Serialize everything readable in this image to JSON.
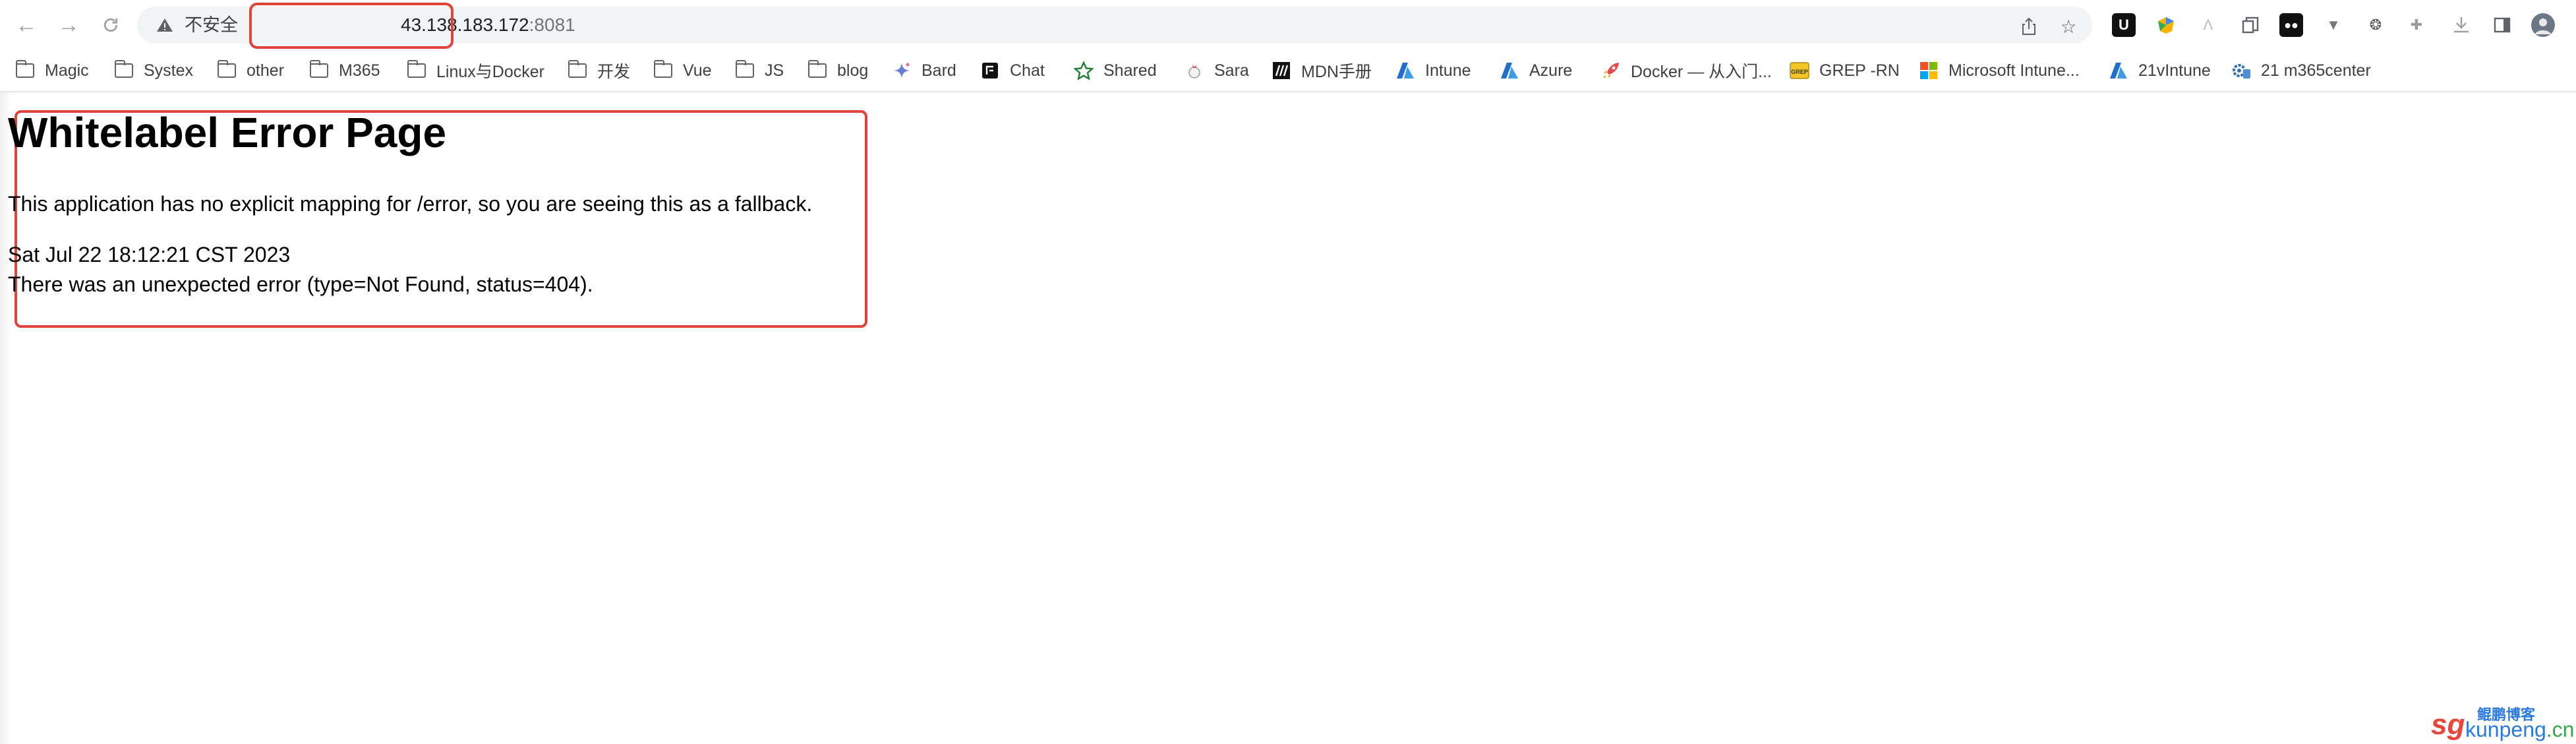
{
  "browser": {
    "address_bar": {
      "security_label": "不安全",
      "url_host": "43.138.183.172",
      "url_port": ":8081"
    }
  },
  "bookmarks": [
    {
      "label": "Magic",
      "icon": "folder-icon"
    },
    {
      "label": "Systex",
      "icon": "folder-icon"
    },
    {
      "label": "other",
      "icon": "folder-icon"
    },
    {
      "label": "M365",
      "icon": "folder-icon"
    },
    {
      "label": "Linux与Docker",
      "icon": "folder-icon"
    },
    {
      "label": "开发",
      "icon": "folder-icon"
    },
    {
      "label": "Vue",
      "icon": "folder-icon"
    },
    {
      "label": "JS",
      "icon": "folder-icon"
    },
    {
      "label": "blog",
      "icon": "folder-icon"
    },
    {
      "label": "Bard",
      "icon": "bard-sparkle-icon"
    },
    {
      "label": "Chat",
      "icon": "chat-icon"
    },
    {
      "label": "Shared",
      "icon": "star-icon"
    },
    {
      "label": "Sara",
      "icon": "rooster-icon"
    },
    {
      "label": "MDN手册",
      "icon": "mdn-icon"
    },
    {
      "label": "Intune",
      "icon": "azure-icon"
    },
    {
      "label": "Azure",
      "icon": "azure-icon"
    },
    {
      "label": "Docker — 从入门...",
      "icon": "rocket-icon"
    },
    {
      "label": "GREP -RN",
      "icon": "grep-icon"
    },
    {
      "label": "Microsoft Intune...",
      "icon": "microsoft-icon"
    },
    {
      "label": "21vIntune",
      "icon": "azure-icon"
    },
    {
      "label": "21 m365center",
      "icon": "gear-icon"
    }
  ],
  "page": {
    "title": "Whitelabel Error Page",
    "message": "This application has no explicit mapping for /error, so you are seeing this as a fallback.",
    "timestamp": "Sat Jul 22 18:12:21 CST 2023",
    "detail": "There was an unexpected error (type=Not Found, status=404)."
  },
  "watermark": {
    "site_name": "鲲鹏博客",
    "prefix": "sg",
    "domain": "kunpeng",
    "tld": ".cn"
  },
  "colors": {
    "highlight_red": "#e0433a",
    "watermark_blue": "#2a7ae2",
    "watermark_green": "#3aa64a"
  }
}
